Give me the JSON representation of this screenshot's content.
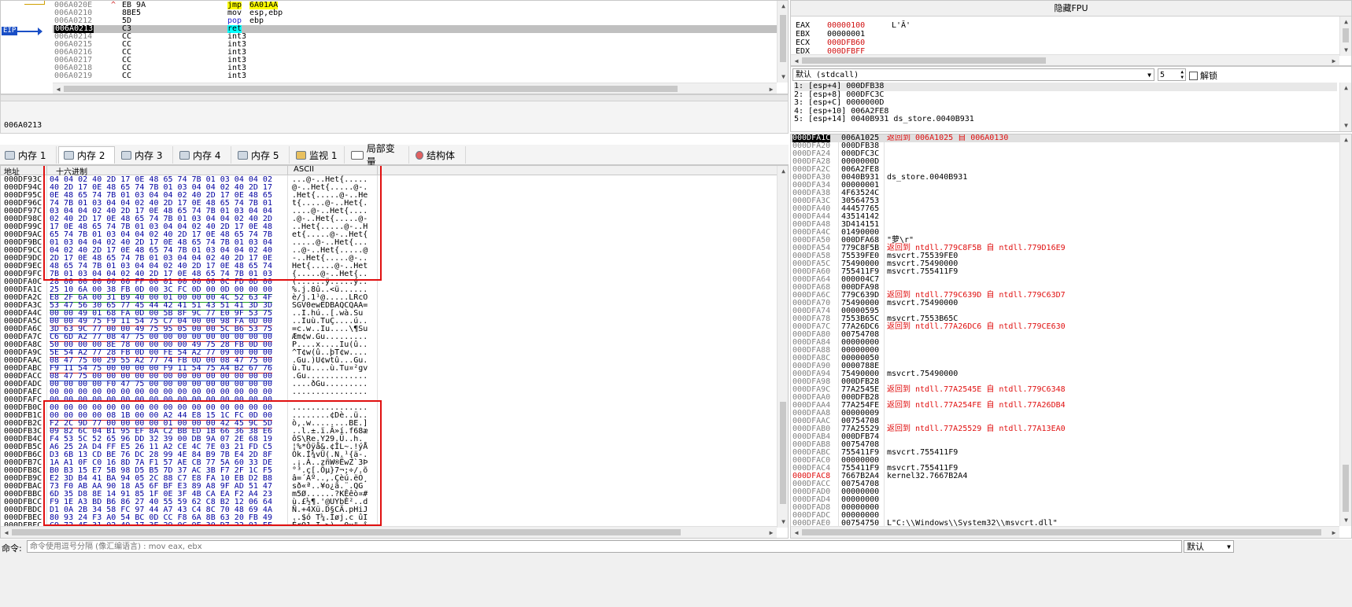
{
  "disasm": {
    "eip_label": "EIP",
    "rows": [
      {
        "addr": "006A020E",
        "arrow": "^",
        "bytes": "EB 9A",
        "instr": "jmp",
        "operand": "6A01AA",
        "kind": "jmp",
        "current": false
      },
      {
        "addr": "006A0210",
        "arrow": "",
        "bytes": "8BE5",
        "instr": "mov",
        "operand": "esp,ebp",
        "kind": "mov",
        "current": false
      },
      {
        "addr": "006A0212",
        "arrow": "",
        "bytes": "5D",
        "instr": "pop",
        "operand": "ebp",
        "kind": "pop",
        "current": false
      },
      {
        "addr": "006A0213",
        "arrow": "",
        "bytes": "C3",
        "instr": "ret",
        "operand": "",
        "kind": "ret",
        "current": true
      },
      {
        "addr": "006A0214",
        "arrow": "",
        "bytes": "CC",
        "instr": "int3",
        "operand": "",
        "kind": "int3",
        "current": false
      },
      {
        "addr": "006A0215",
        "arrow": "",
        "bytes": "CC",
        "instr": "int3",
        "operand": "",
        "kind": "int3",
        "current": false
      },
      {
        "addr": "006A0216",
        "arrow": "",
        "bytes": "CC",
        "instr": "int3",
        "operand": "",
        "kind": "int3",
        "current": false
      },
      {
        "addr": "006A0217",
        "arrow": "",
        "bytes": "CC",
        "instr": "int3",
        "operand": "",
        "kind": "int3",
        "current": false
      },
      {
        "addr": "006A0218",
        "arrow": "",
        "bytes": "CC",
        "instr": "int3",
        "operand": "",
        "kind": "int3",
        "current": false
      },
      {
        "addr": "006A0219",
        "arrow": "",
        "bytes": "CC",
        "instr": "int3",
        "operand": "",
        "kind": "int3",
        "current": false
      }
    ],
    "info_line": "006A0213"
  },
  "registers": {
    "title": "隐藏FPU",
    "rows": [
      {
        "name": "EAX",
        "value": "00000100",
        "extra": "L'Ā'",
        "changed": true
      },
      {
        "name": "EBX",
        "value": "00000001",
        "extra": "",
        "changed": false
      },
      {
        "name": "ECX",
        "value": "000DFB60",
        "extra": "",
        "changed": true
      },
      {
        "name": "EDX",
        "value": "000DFBFF",
        "extra": "",
        "changed": true
      }
    ]
  },
  "callconv": {
    "selected": "默认 (stdcall)",
    "count": "5",
    "unlock_label": "解锁",
    "args": [
      "1: [esp+4] 000DFB38",
      "2: [esp+8] 000DFC3C",
      "3: [esp+C] 0000000D",
      "4: [esp+10] 006A2FE8",
      "5: [esp+14] 0040B931 ds_store.0040B931"
    ]
  },
  "tabs": [
    {
      "label": "内存 1",
      "icon": "memory-icon",
      "active": false
    },
    {
      "label": "内存 2",
      "icon": "memory-icon",
      "active": true
    },
    {
      "label": "内存 3",
      "icon": "memory-icon",
      "active": false
    },
    {
      "label": "内存 4",
      "icon": "memory-icon",
      "active": false
    },
    {
      "label": "内存 5",
      "icon": "memory-icon",
      "active": false
    },
    {
      "label": "监视 1",
      "icon": "watch-icon",
      "active": false
    },
    {
      "label": "局部变量",
      "icon": "locals-icon",
      "active": false
    },
    {
      "label": "结构体",
      "icon": "struct-icon",
      "active": false
    }
  ],
  "dump": {
    "col_addr": "地址",
    "col_hex": "十六进制",
    "col_ascii": "ASCII",
    "rows": [
      {
        "a": "000DF93C",
        "h": "04 04 02 40 2D 17 0E 48 65 74 7B 01 03 04 04 02",
        "s": "...@-..Het{....."
      },
      {
        "a": "000DF94C",
        "h": "40 2D 17 0E 48 65 74 7B 01 03 04 04 02 40 2D 17",
        "s": "@-..Het{.....@-."
      },
      {
        "a": "000DF95C",
        "h": "0E 48 65 74 7B 01 03 04 04 02 40 2D 17 0E 48 65",
        "s": ".Het{.....@-..He"
      },
      {
        "a": "000DF96C",
        "h": "74 7B 01 03 04 04 02 40 2D 17 0E 48 65 74 7B 01",
        "s": "t{.....@-..Het{."
      },
      {
        "a": "000DF97C",
        "h": "03 04 04 02 40 2D 17 0E 48 65 74 7B 01 03 04 04",
        "s": "....@-..Het{...."
      },
      {
        "a": "000DF98C",
        "h": "02 40 2D 17 0E 48 65 74 7B 01 03 04 04 02 40 2D",
        "s": ".@-..Het{.....@-"
      },
      {
        "a": "000DF99C",
        "h": "17 0E 48 65 74 7B 01 03 04 04 02 40 2D 17 0E 48",
        "s": "..Het{.....@-..H"
      },
      {
        "a": "000DF9AC",
        "h": "65 74 7B 01 03 04 04 02 40 2D 17 0E 48 65 74 7B",
        "s": "et{.....@-..Het{"
      },
      {
        "a": "000DF9BC",
        "h": "01 03 04 04 02 40 2D 17 0E 48 65 74 7B 01 03 04",
        "s": ".....@-..Het{..."
      },
      {
        "a": "000DF9CC",
        "h": "04 02 40 2D 17 0E 48 65 74 7B 01 03 04 04 02 40",
        "s": "..@-..Het{.....@"
      },
      {
        "a": "000DF9DC",
        "h": "2D 17 0E 48 65 74 7B 01 03 04 04 02 40 2D 17 0E",
        "s": "-..Het{.....@-.."
      },
      {
        "a": "000DF9EC",
        "h": "48 65 74 7B 01 03 04 04 02 40 2D 17 0E 48 65 74",
        "s": "Het{.....@-..Het"
      },
      {
        "a": "000DF9FC",
        "h": "7B 01 03 04 04 02 40 2D 17 0E 48 65 74 7B 01 03",
        "s": "{.....@-..Het{.."
      },
      {
        "a": "000DFA0C",
        "h": "28 00 00 00 00 00 FF 00 01 00 00 00 0C FD 0D 00",
        "s": "(......ÿ.....ý.."
      },
      {
        "a": "000DFA1C",
        "h": "25 10 6A 00 38 FB 0D 00 3C FC 0D 00 0D 00 00 00",
        "s": "%.j.8û..<ü......"
      },
      {
        "a": "000DFA2C",
        "h": "E8 2F 6A 00 31 B9 40 00 01 00 00 00 4C 52 63 4F",
        "s": "è/j.1¹@.....LRcO"
      },
      {
        "a": "000DFA3C",
        "h": "53 47 56 30 65 77 45 44 42 41 51 43 51 41 3D 3D",
        "s": "SGV0ewEDBAQCQAA="
      },
      {
        "a": "000DFA4C",
        "h": "00 00 49 01 68 FA 0D 00 5B 8F 9C 77 E0 9F 53 75",
        "s": "..I.hú..[.wà.Su"
      },
      {
        "a": "000DFA5C",
        "h": "00 00 49 75 F9 11 54 75 C7 04 00 00 98 FA 0D 00",
        "s": "..Iuù.TuÇ....ú.."
      },
      {
        "a": "000DFA6C",
        "h": "3D 63 9C 77 00 00 49 75 95 05 00 00 5C B6 53 75",
        "s": "=c.w..Iu....\\¶Su"
      },
      {
        "a": "000DFA7C",
        "h": "C6 6D A2 77 08 47 75 00 00 00 00 00 00 00 00 00",
        "s": "Æm¢w.Gu........."
      },
      {
        "a": "000DFA8C",
        "h": "50 00 00 00 8E 78 00 00 00 00 49 75 28 FB 0D 00",
        "s": "P....x....Iu(û.."
      },
      {
        "a": "000DFA9C",
        "h": "5E 54 A2 77 28 FB 0D 00 FE 54 A2 77 09 00 00 00",
        "s": "^T¢w(û..þT¢w...."
      },
      {
        "a": "000DFAAC",
        "h": "08 47 75 00 29 55 A2 77 74 FB 0D 00 08 47 75 00",
        "s": ".Gu.)U¢wtû...Gu."
      },
      {
        "a": "000DFABC",
        "h": "F9 11 54 75 00 00 00 00 F9 11 54 75 A4 B2 67 76",
        "s": "ù.Tu....ù.Tu¤²gv"
      },
      {
        "a": "000DFACC",
        "h": "08 47 75 00 00 00 00 00 00 00 00 00 00 00 00 00",
        "s": ".Gu............."
      },
      {
        "a": "000DFADC",
        "h": "00 00 00 00 F0 47 75 00 00 00 00 00 00 00 00 00",
        "s": "....ðGu........."
      },
      {
        "a": "000DFAEC",
        "h": "00 00 00 00 00 00 00 00 00 00 00 00 00 00 00 00",
        "s": "................"
      },
      {
        "a": "000DFAFC",
        "h": "00 00 00 00 00 00 00 00 00 00 00 00 00 00 00 00",
        "s": "................"
      },
      {
        "a": "000DFB0C",
        "h": "00 00 00 00 00 00 00 00 00 00 00 00 00 00 00 00",
        "s": "................"
      },
      {
        "a": "000DFB1C",
        "h": "00 00 00 00 08 1B 00 00 A2 44 E8 15 1C FC 0D 00",
        "s": "........¢Dè..ü.."
      },
      {
        "a": "000DFB2C",
        "h": "F2 2C 9D 77 00 00 00 00 01 00 00 00 42 45 9C 5D",
        "s": "ò,.w........BE.]"
      },
      {
        "a": "000DFB3C",
        "h": "09 82 6C 04 B1 95 EF 8A C2 BB ED 1B 66 36 38 E6",
        "s": "..l.±.ï.Â»í.f68æ"
      },
      {
        "a": "000DFB4C",
        "h": "F4 53 5C 52 65 96 DD 32 39 00 DB 9A 07 2E 68 19",
        "s": "ôS\\Re.Y29.Û..h."
      },
      {
        "a": "000DFB5C",
        "h": "A6 25 2A D4 FF E5 26 11 A2 CE 4C 7E 03 21 FD C5",
        "s": "¦%*Ôÿå&.¢ÎL~.!ýÅ"
      },
      {
        "a": "000DFB6C",
        "h": "D3 6B 13 CD BE 76 DC 28 99 4E 84 B9 7B E4 2D 8F",
        "s": "Ók.Í¾vÜ(.N.¹{ä-."
      },
      {
        "a": "000DFB7C",
        "h": "1A A1 0F C0 16 8D 7A F1 57 AE CB 77 5A 60 33 DE",
        "s": ".¡.À..zñW®ËwZ`3Þ"
      },
      {
        "a": "000DFB8C",
        "h": "B0 B3 15 E7 5B 98 D5 B5 7D 37 AC 3B F7 2F 1C F5",
        "s": "°³.ç[.Õµ}7¬;÷/.õ"
      },
      {
        "a": "000DFB9C",
        "h": "E2 3D B4 41 BA 94 05 2C 88 C7 E8 FA 10 EB D2 B8",
        "s": "â=´Aº..,.Çèú.ëÒ¸"
      },
      {
        "a": "000DFBAC",
        "h": "73 F0 AB AA 90 18 A5 6F BF E3 89 A8 9F AD 51 47",
        "s": "sð«ª..¥o¿ã.¨.­QG"
      },
      {
        "a": "000DFBBC",
        "h": "6D 35 D8 8E 14 91 85 1F 0E 3F 4B CA EA F2 A4 23",
        "s": "m5Ø......?KÊêò¤#"
      },
      {
        "a": "000DFBCC",
        "h": "F9 1E A3 BD B6 86 27 40 55 59 62 C8 B2 12 06 64",
        "s": "ù.£½¶.'@UYbÈ²..d"
      },
      {
        "a": "000DFBDC",
        "h": "D1 0A 2B 34 58 FC 97 44 A7 43 C4 8C 70 48 69 4A",
        "s": "Ñ.+4Xü.D§CÄ.pHiJ"
      },
      {
        "a": "000DFBEC",
        "h": "80 93 24 F3 A0 54 BC 0D CC F8 6A 8B 63 20 FB 49",
        "s": "..$ó T¼.Ìøj.c ûI"
      },
      {
        "a": "000DFBFC",
        "h": "C9 72 4F 31 02 49 17 3E 29 0C 9E 30 D7 22 01 EE",
        "s": "ÉrO1.I.>)..0×\".î"
      },
      {
        "a": "000DFC0C",
        "h": "67 5F CF 9B F6 EC C6 0B AF 6E 81 50 B7 75 3A 79",
        "s": "g_Ï.öìÆ.¯n.P·u:y"
      }
    ]
  },
  "stack": {
    "rows": [
      {
        "a": "000DFA1C",
        "v": "006A1025",
        "c": "返回到 006A1025 自 006A0130",
        "ret": true,
        "top": true
      },
      {
        "a": "000DFA20",
        "v": "000DFB38",
        "c": "",
        "ret": false,
        "top": false
      },
      {
        "a": "000DFA24",
        "v": "000DFC3C",
        "c": "",
        "ret": false,
        "top": false
      },
      {
        "a": "000DFA28",
        "v": "0000000D",
        "c": "",
        "ret": false,
        "top": false
      },
      {
        "a": "000DFA2C",
        "v": "006A2FE8",
        "c": "",
        "ret": false,
        "top": false
      },
      {
        "a": "000DFA30",
        "v": "0040B931",
        "c": "ds_store.0040B931",
        "ret": false,
        "top": false
      },
      {
        "a": "000DFA34",
        "v": "00000001",
        "c": "",
        "ret": false,
        "top": false
      },
      {
        "a": "000DFA38",
        "v": "4F63524C",
        "c": "",
        "ret": false,
        "top": false
      },
      {
        "a": "000DFA3C",
        "v": "30564753",
        "c": "",
        "ret": false,
        "top": false
      },
      {
        "a": "000DFA40",
        "v": "44457765",
        "c": "",
        "ret": false,
        "top": false
      },
      {
        "a": "000DFA44",
        "v": "43514142",
        "c": "",
        "ret": false,
        "top": false
      },
      {
        "a": "000DFA48",
        "v": "3D414151",
        "c": "",
        "ret": false,
        "top": false
      },
      {
        "a": "000DFA4C",
        "v": "01490000",
        "c": "",
        "ret": false,
        "top": false
      },
      {
        "a": "000DFA50",
        "v": "000DFA68",
        "c": "\"萝\\r\"",
        "ret": false,
        "top": false
      },
      {
        "a": "000DFA54",
        "v": "779C8F5B",
        "c": "返回到 ntdll.779C8F5B 自 ntdll.779D16E9",
        "ret": true,
        "top": false
      },
      {
        "a": "000DFA58",
        "v": "75539FE0",
        "c": "msvcrt.75539FE0",
        "ret": false,
        "top": false
      },
      {
        "a": "000DFA5C",
        "v": "75490000",
        "c": "msvcrt.75490000",
        "ret": false,
        "top": false
      },
      {
        "a": "000DFA60",
        "v": "755411F9",
        "c": "msvcrt.755411F9",
        "ret": false,
        "top": false
      },
      {
        "a": "000DFA64",
        "v": "000004C7",
        "c": "",
        "ret": false,
        "top": false
      },
      {
        "a": "000DFA68",
        "v": "000DFA98",
        "c": "",
        "ret": false,
        "top": false
      },
      {
        "a": "000DFA6C",
        "v": "779C639D",
        "c": "返回到 ntdll.779C639D 自 ntdll.779C63D7",
        "ret": true,
        "top": false
      },
      {
        "a": "000DFA70",
        "v": "75490000",
        "c": "msvcrt.75490000",
        "ret": false,
        "top": false
      },
      {
        "a": "000DFA74",
        "v": "00000595",
        "c": "",
        "ret": false,
        "top": false
      },
      {
        "a": "000DFA78",
        "v": "7553B65C",
        "c": "msvcrt.7553B65C",
        "ret": false,
        "top": false
      },
      {
        "a": "000DFA7C",
        "v": "77A26DC6",
        "c": "返回到 ntdll.77A26DC6 自 ntdll.779CE630",
        "ret": true,
        "top": false
      },
      {
        "a": "000DFA80",
        "v": "00754708",
        "c": "",
        "ret": false,
        "top": false
      },
      {
        "a": "000DFA84",
        "v": "00000000",
        "c": "",
        "ret": false,
        "top": false
      },
      {
        "a": "000DFA88",
        "v": "00000000",
        "c": "",
        "ret": false,
        "top": false
      },
      {
        "a": "000DFA8C",
        "v": "00000050",
        "c": "",
        "ret": false,
        "top": false
      },
      {
        "a": "000DFA90",
        "v": "0000788E",
        "c": "",
        "ret": false,
        "top": false
      },
      {
        "a": "000DFA94",
        "v": "75490000",
        "c": "msvcrt.75490000",
        "ret": false,
        "top": false
      },
      {
        "a": "000DFA98",
        "v": "000DFB28",
        "c": "",
        "ret": false,
        "top": false
      },
      {
        "a": "000DFA9C",
        "v": "77A2545E",
        "c": "返回到 ntdll.77A2545E 自 ntdll.779C6348",
        "ret": true,
        "top": false
      },
      {
        "a": "000DFAA0",
        "v": "000DFB28",
        "c": "",
        "ret": false,
        "top": false
      },
      {
        "a": "000DFAA4",
        "v": "77A254FE",
        "c": "返回到 ntdll.77A254FE 自 ntdll.77A26DB4",
        "ret": true,
        "top": false
      },
      {
        "a": "000DFAA8",
        "v": "00000009",
        "c": "",
        "ret": false,
        "top": false
      },
      {
        "a": "000DFAAC",
        "v": "00754708",
        "c": "",
        "ret": false,
        "top": false
      },
      {
        "a": "000DFAB0",
        "v": "77A25529",
        "c": "返回到 ntdll.77A25529 自 ntdll.77A13EA0",
        "ret": true,
        "top": false
      },
      {
        "a": "000DFAB4",
        "v": "000DFB74",
        "c": "",
        "ret": false,
        "top": false
      },
      {
        "a": "000DFAB8",
        "v": "00754708",
        "c": "",
        "ret": false,
        "top": false
      },
      {
        "a": "000DFABC",
        "v": "755411F9",
        "c": "msvcrt.755411F9",
        "ret": false,
        "top": false
      },
      {
        "a": "000DFAC0",
        "v": "00000000",
        "c": "",
        "ret": false,
        "top": false
      },
      {
        "a": "000DFAC4",
        "v": "755411F9",
        "c": "msvcrt.755411F9",
        "ret": false,
        "top": false
      },
      {
        "a": "000DFAC8",
        "v": "7667B2A4",
        "c": "kernel32.7667B2A4",
        "ret": false,
        "top": false,
        "addr_red": true
      },
      {
        "a": "000DFACC",
        "v": "00754708",
        "c": "",
        "ret": false,
        "top": false
      },
      {
        "a": "000DFAD0",
        "v": "00000000",
        "c": "",
        "ret": false,
        "top": false
      },
      {
        "a": "000DFAD4",
        "v": "00000000",
        "c": "",
        "ret": false,
        "top": false
      },
      {
        "a": "000DFAD8",
        "v": "00000000",
        "c": "",
        "ret": false,
        "top": false
      },
      {
        "a": "000DFADC",
        "v": "00000000",
        "c": "",
        "ret": false,
        "top": false
      },
      {
        "a": "000DFAE0",
        "v": "00754750",
        "c": "L\"C:\\\\Windows\\\\System32\\\\msvcrt.dll\"",
        "ret": false,
        "top": false
      }
    ]
  },
  "command": {
    "label": "命令:",
    "placeholder": "命令使用逗号分隔 (像汇编语言) : mov eax, ebx",
    "mode": "默认"
  },
  "colors": {
    "current_row": "#c0c0c0",
    "changed_reg": "#d01010",
    "hex_blue": "#0000a0",
    "addr_gray": "#808080",
    "ret_red": "#e01010"
  }
}
